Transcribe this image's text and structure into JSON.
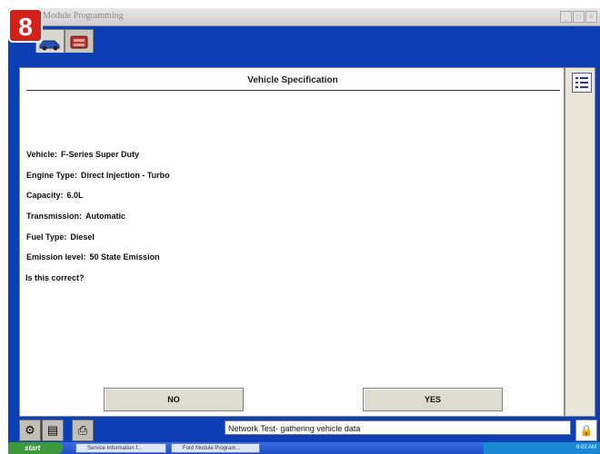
{
  "badge": {
    "number": "8"
  },
  "window": {
    "title": "Module Programming"
  },
  "content": {
    "heading": "Vehicle Specification",
    "specs": [
      {
        "label": "Vehicle:",
        "value": "F-Series Super Duty"
      },
      {
        "label": "Engine Type:",
        "value": "Direct Injection - Turbo"
      },
      {
        "label": "Capacity:",
        "value": "6.0L"
      },
      {
        "label": "Transmission:",
        "value": "Automatic"
      },
      {
        "label": "Fuel Type:",
        "value": "Diesel"
      },
      {
        "label": "Emission level:",
        "value": "50 State Emission"
      }
    ],
    "question": "Is this correct?",
    "no_label": "NO",
    "yes_label": "YES"
  },
  "status": {
    "message": "Network Test- gathering vehicle data"
  },
  "taskbar": {
    "start_label": "start",
    "tasks": [
      "Service Information f...",
      "Ford Module Program..."
    ],
    "clock": "9:02 AM"
  }
}
